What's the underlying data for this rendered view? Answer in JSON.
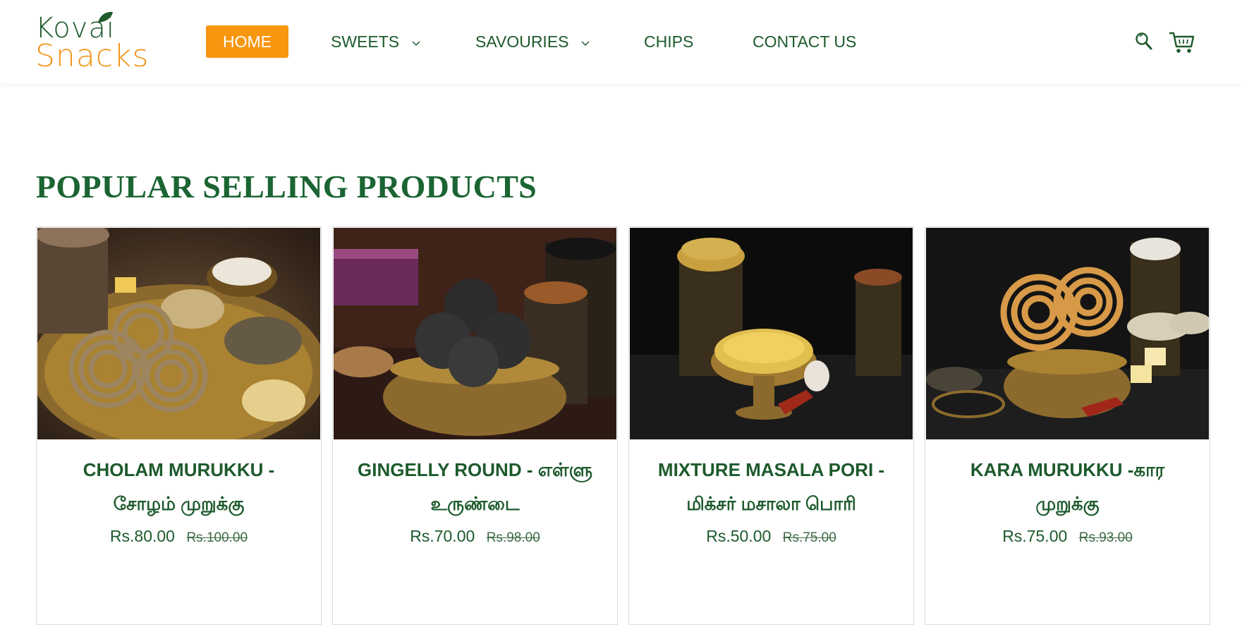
{
  "brand": {
    "line1": "Kovai",
    "line2": "Snacks"
  },
  "nav": {
    "home": "HOME",
    "sweets": "SWEETS",
    "savouries": "SAVOURIES",
    "chips": "CHIPS",
    "contact": "CONTACT US"
  },
  "header_icons": [
    "search-icon",
    "cart-icon"
  ],
  "section": {
    "title": "POPULAR SELLING PRODUCTS"
  },
  "products": [
    {
      "name": "CHOLAM MURUKKU - சோழம் முறுக்கு",
      "price": "Rs.80.00",
      "old_price": "Rs.100.00"
    },
    {
      "name": "GINGELLY ROUND - எள்ளு உருண்டை",
      "price": "Rs.70.00",
      "old_price": "Rs.98.00"
    },
    {
      "name": "MIXTURE MASALA PORI - மிக்சர் மசாலா பொரி",
      "price": "Rs.50.00",
      "old_price": "Rs.75.00"
    },
    {
      "name": "KARA MURUKKU -கார முறுக்கு",
      "price": "Rs.75.00",
      "old_price": "Rs.93.00"
    }
  ],
  "colors": {
    "brand_green": "#1d5a2c",
    "brand_orange": "#f7960f"
  }
}
